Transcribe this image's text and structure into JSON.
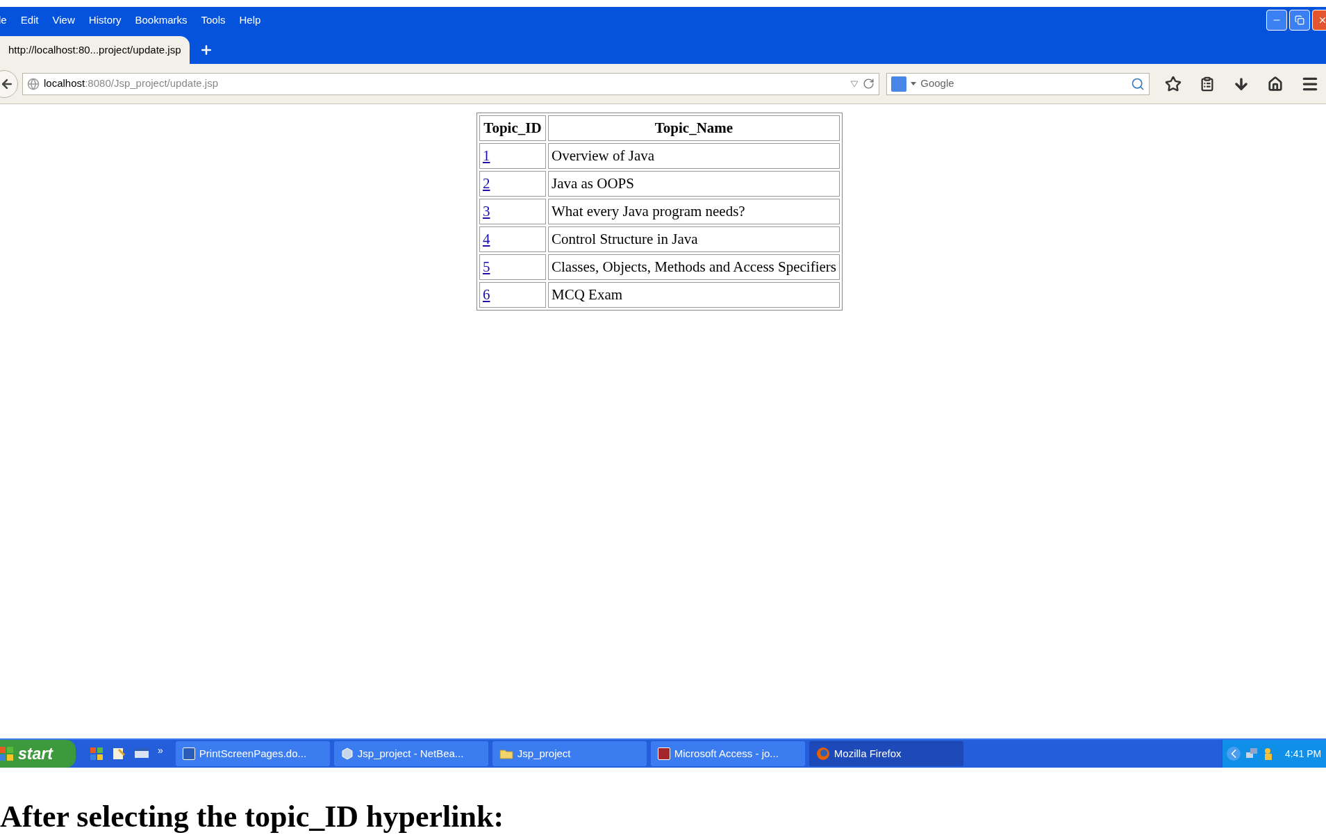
{
  "menu": [
    "le",
    "Edit",
    "View",
    "History",
    "Bookmarks",
    "Tools",
    "Help"
  ],
  "tabs": [
    {
      "title": "http://localhost:80...project/update.jsp",
      "selected": true
    }
  ],
  "address": {
    "host": "localhost",
    "path": ":8080/Jsp_project/update.jsp"
  },
  "search": {
    "placeholder": "Google"
  },
  "table": {
    "columns": [
      "Topic_ID",
      "Topic_Name"
    ],
    "rows": [
      {
        "id": "1",
        "name": "Overview of Java"
      },
      {
        "id": "2",
        "name": "Java as OOPS"
      },
      {
        "id": "3",
        "name": "What every Java program needs?"
      },
      {
        "id": "4",
        "name": "Control Structure in Java"
      },
      {
        "id": "5",
        "name": "Classes, Objects, Methods and Access Specifiers"
      },
      {
        "id": "6",
        "name": "MCQ Exam"
      }
    ]
  },
  "taskbar": {
    "start": "start",
    "overflow": "»",
    "tasks": [
      {
        "label": "PrintScreenPages.do...",
        "kind": "word",
        "selected": false
      },
      {
        "label": "Jsp_project - NetBea...",
        "kind": "cube",
        "selected": false
      },
      {
        "label": "Jsp_project",
        "kind": "folder",
        "selected": false
      },
      {
        "label": "Microsoft Access - jo...",
        "kind": "access",
        "selected": false
      },
      {
        "label": "Mozilla Firefox",
        "kind": "firefox",
        "selected": true
      }
    ],
    "clock": "4:41 PM"
  },
  "caption": "After selecting the topic_ID hyperlink:"
}
